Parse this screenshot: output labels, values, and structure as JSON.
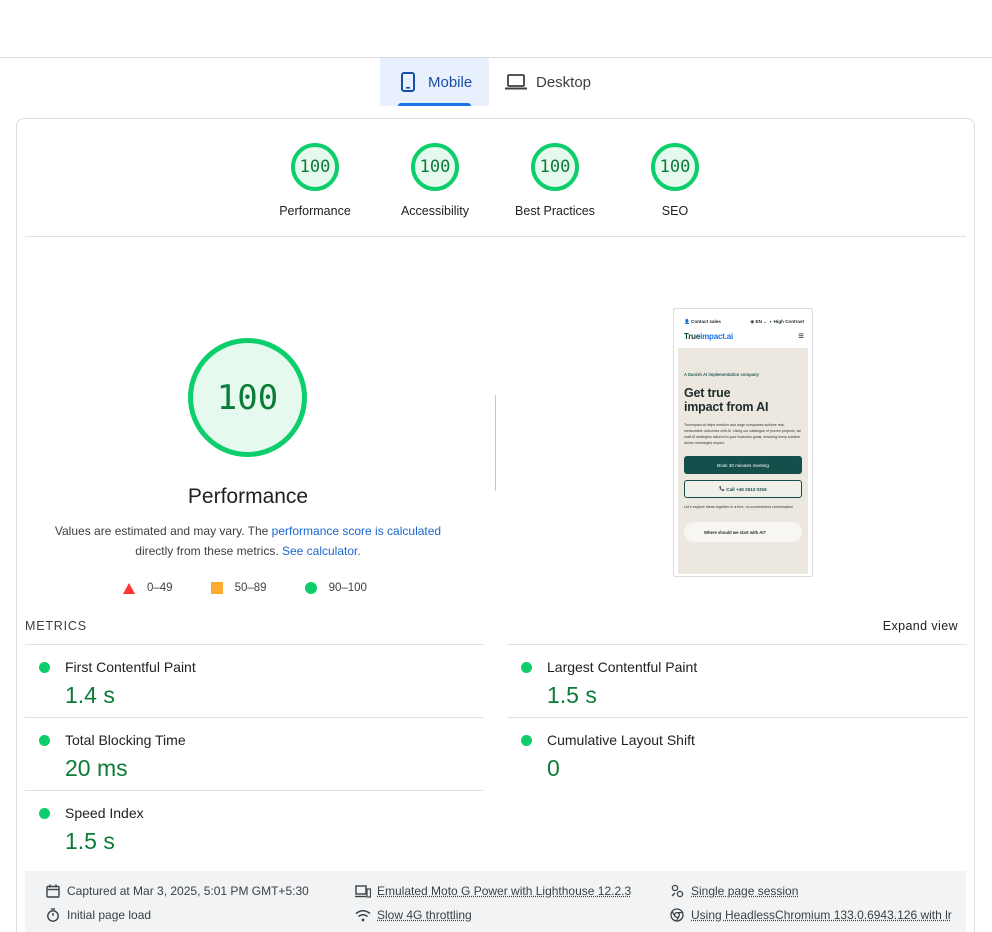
{
  "tabs": {
    "mobile": "Mobile",
    "desktop": "Desktop"
  },
  "category_scores": [
    {
      "score": "100",
      "label": "Performance"
    },
    {
      "score": "100",
      "label": "Accessibility"
    },
    {
      "score": "100",
      "label": "Best Practices"
    },
    {
      "score": "100",
      "label": "SEO"
    }
  ],
  "performance": {
    "score": "100",
    "title": "Performance",
    "note_prefix": "Values are estimated and may vary. The ",
    "note_link": "performance score is calculated",
    "note_middle": " directly from these metrics. ",
    "calculator_link": "See calculator.",
    "legend": [
      {
        "range": "0–49",
        "color": "#ff3333"
      },
      {
        "range": "50–89",
        "color": "#ffaa33"
      },
      {
        "range": "90–100",
        "color": "#0cce6b"
      }
    ]
  },
  "screenshot": {
    "contact": "Contact sales",
    "lang": "EN",
    "contrast": "High Contrast",
    "logo_a": "True",
    "logo_b": "impact.ai",
    "eyebrow": "A Danish AI implementation company",
    "heading_1": "Get true",
    "heading_2": "impact from AI",
    "para": "Trueimpact.ai helps medium and large companies achieve real, measurable outcomes with AI. Using our catalogue of proven projects, we craft AI strategies tailored to your business goals, ensuring every solution drives meaningful impact.",
    "btn_primary": "Book 30 minutes meeting",
    "btn_secondary": "Call +45 2613 0316",
    "small": "Let's explore ideas together in a free, no-commitment conversation",
    "chat": "Where should we start with AI?"
  },
  "metrics": {
    "header": "METRICS",
    "expand": "Expand view",
    "items": [
      {
        "name": "First Contentful Paint",
        "value": "1.4 s",
        "status": "#0cce6b"
      },
      {
        "name": "Largest Contentful Paint",
        "value": "1.5 s",
        "status": "#0cce6b"
      },
      {
        "name": "Total Blocking Time",
        "value": "20 ms",
        "status": "#0cce6b"
      },
      {
        "name": "Cumulative Layout Shift",
        "value": "0",
        "status": "#0cce6b"
      },
      {
        "name": "Speed Index",
        "value": "1.5 s",
        "status": "#0cce6b"
      }
    ]
  },
  "footer": {
    "captured": "Captured at Mar 3, 2025, 5:01 PM GMT+5:30",
    "load": "Initial page load",
    "device": "Emulated Moto G Power with Lighthouse 12.2.3",
    "throttling": "Slow 4G throttling",
    "session": "Single page session",
    "browser": "Using HeadlessChromium 133.0.6943.126 with lr"
  },
  "colors": {
    "pass": "#0cce6b",
    "pass_text": "#0b7c38",
    "accent": "#1a73e8"
  }
}
